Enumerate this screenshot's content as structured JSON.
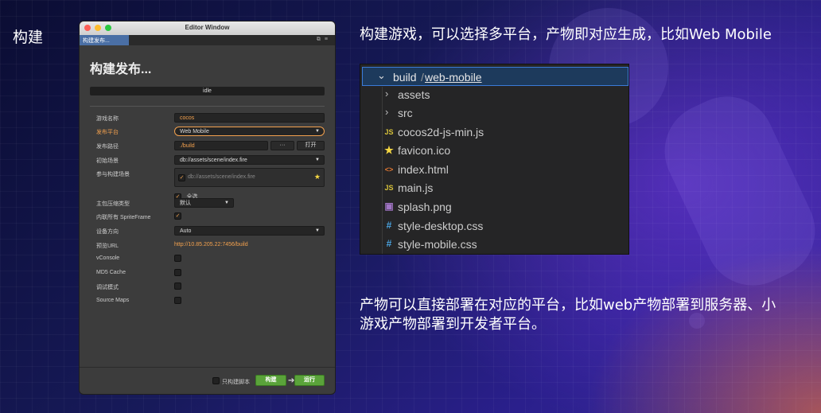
{
  "slide": {
    "title": "构建",
    "top_desc": "构建游戏，可以选择多平台，产物即对应生成，比如Web Mobile",
    "bottom_desc": "产物可以直接部署在对应的平台，比如web产物部署到服务器、小游戏产物部署到开发者平台。"
  },
  "window": {
    "title": "Editor Window",
    "tab": "构建发布...",
    "panel_title": "构建发布...",
    "status": "idle",
    "fields": {
      "game_name_label": "游戏名称",
      "game_name_value": "cocos",
      "platform_label": "发布平台",
      "platform_value": "Web Mobile",
      "path_label": "发布路径",
      "path_value": "./build",
      "path_browse": "···",
      "path_open": "打开",
      "start_scene_label": "初始场景",
      "start_scene_value": "db://assets/scene/index.fire",
      "included_scenes_label": "参与构建场景",
      "included_scene_item": "db://assets/scene/index.fire",
      "select_all": "全选",
      "compress_label": "主包压缩类型",
      "compress_value": "默认",
      "inline_sf_label": "内联所有 SpriteFrame",
      "orientation_label": "设备方向",
      "orientation_value": "Auto",
      "preview_url_label": "预览URL",
      "preview_url_value": "http://10.85.205.22:7456/build",
      "vconsole_label": "vConsole",
      "md5_label": "MD5 Cache",
      "debug_label": "调试模式",
      "sourcemaps_label": "Source Maps"
    },
    "footer": {
      "build_script_only": "只构建脚本",
      "build_button": "构建",
      "run_button": "运行"
    }
  },
  "explorer": {
    "root_parent": "build",
    "root_folder": "web-mobile",
    "items": [
      {
        "name": "assets",
        "type": "folder",
        "icon": ""
      },
      {
        "name": "src",
        "type": "folder",
        "icon": ""
      },
      {
        "name": "cocos2d-js-min.js",
        "type": "js",
        "icon": "JS"
      },
      {
        "name": "favicon.ico",
        "type": "ico",
        "icon": "★"
      },
      {
        "name": "index.html",
        "type": "html",
        "icon": "<>"
      },
      {
        "name": "main.js",
        "type": "js",
        "icon": "JS"
      },
      {
        "name": "splash.png",
        "type": "image",
        "icon": "▣"
      },
      {
        "name": "style-desktop.css",
        "type": "css",
        "icon": "#"
      },
      {
        "name": "style-mobile.css",
        "type": "css",
        "icon": "#"
      }
    ]
  },
  "colors": {
    "accent_orange": "#f3a14e",
    "green_button": "#5aa33a",
    "js_icon": "#d8c33a",
    "css_icon": "#4aa3df",
    "html_icon": "#e37933",
    "ico_icon": "#f5d742",
    "png_icon": "#a074c4"
  }
}
